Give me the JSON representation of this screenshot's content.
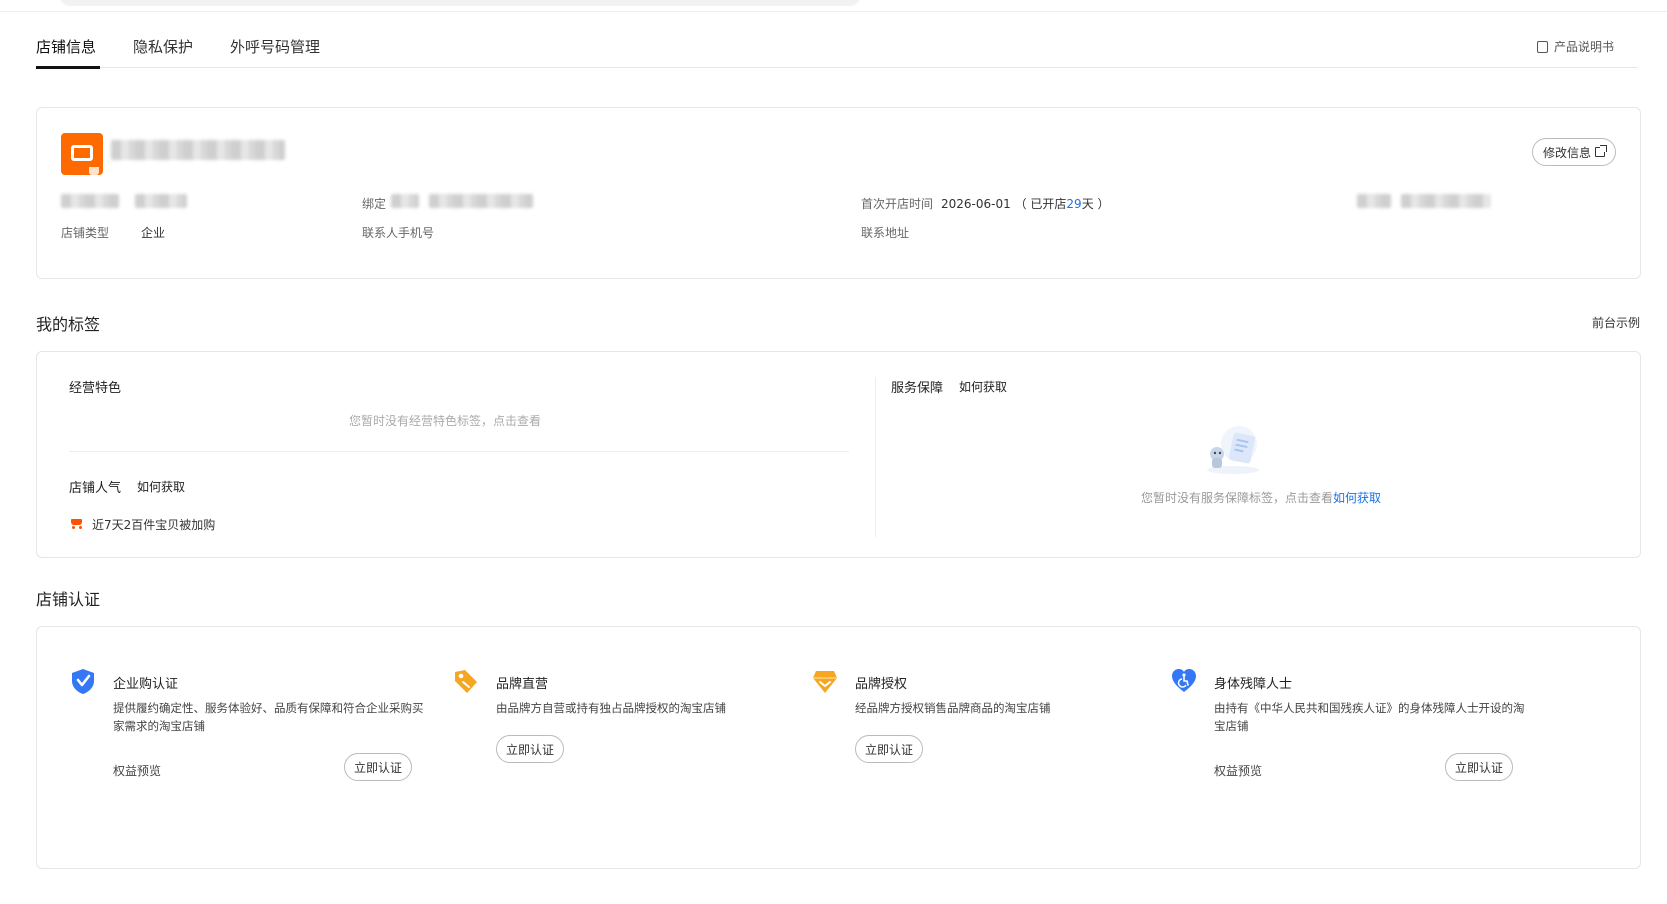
{
  "tabs": [
    {
      "label": "店铺信息"
    },
    {
      "label": "隐私保护"
    },
    {
      "label": "外呼号码管理"
    }
  ],
  "product_manual": "产品说明书",
  "shop_info": {
    "edit_button": "修改信息",
    "shop_type_label": "店铺类型",
    "shop_type_value": "企业",
    "bind_label_partial": "绑定",
    "contact_phone_label": "联系人手机号",
    "open_time_label": "首次开店时间",
    "open_date": "2026-06-01",
    "open_days_prefix": "（ 已开店",
    "open_days": "29",
    "open_days_suffix": "天 ）",
    "contact_address_label": "联系地址"
  },
  "my_tags": {
    "title": "我的标签",
    "frontend_example": "前台示例",
    "business_features": "经营特色",
    "business_features_empty": "您暂时没有经营特色标签，点击查看",
    "shop_popularity": "店铺人气",
    "how_to_get": "如何获取",
    "popularity_item": "近7天2百件宝贝被加购",
    "service_guarantee": "服务保障",
    "service_empty": "您暂时没有服务保障标签，点击查看",
    "service_empty_link": "如何获取"
  },
  "certification": {
    "title": "店铺认证",
    "items": [
      {
        "name": "企业购认证",
        "icon": "shield-check-icon",
        "desc": "提供履约确定性、服务体验好、品质有保障和符合企业采购买家需求的淘宝店铺",
        "benefit": "权益预览",
        "button": "立即认证"
      },
      {
        "name": "品牌直营",
        "icon": "tag-icon",
        "desc": "由品牌方自营或持有独占品牌授权的淘宝店铺",
        "button": "立即认证"
      },
      {
        "name": "品牌授权",
        "icon": "diamond-badge-icon",
        "desc": "经品牌方授权销售品牌商品的淘宝店铺",
        "button": "立即认证"
      },
      {
        "name": "身体残障人士",
        "icon": "heart-accessibility-icon",
        "desc": "由持有《中华人民共和国残疾人证》的身体残障人士开设的淘宝店铺",
        "benefit": "权益预览",
        "button": "立即认证"
      }
    ]
  },
  "colors": {
    "accent_blue": "#1a73e8",
    "brand_orange": "#ff6a00",
    "cert_blue": "#3478f6",
    "cert_orange": "#f5a623"
  }
}
